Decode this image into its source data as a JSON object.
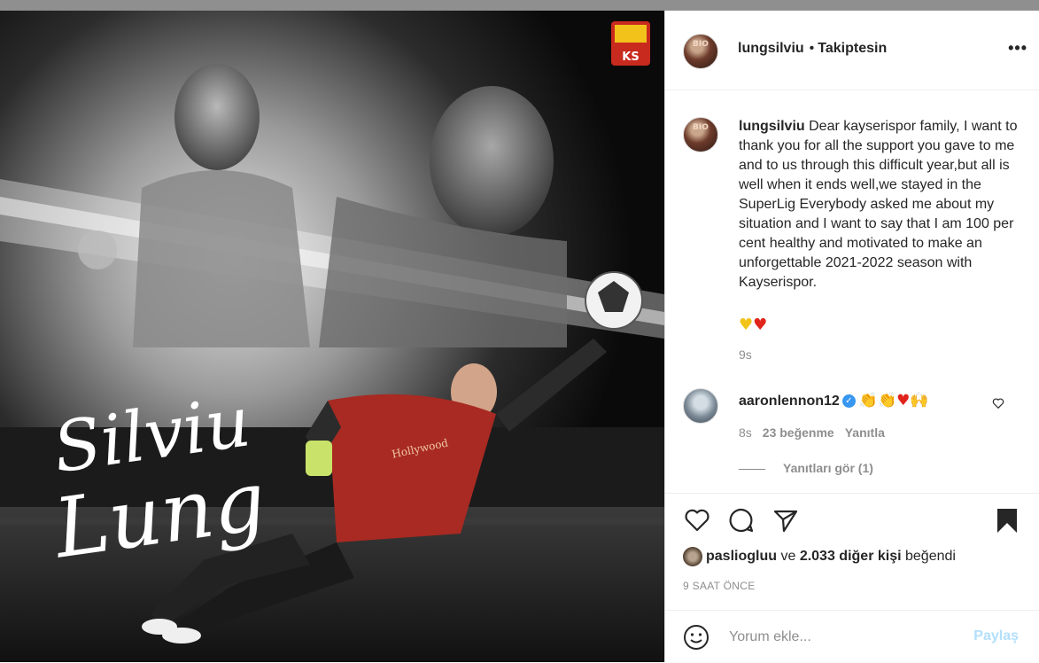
{
  "post": {
    "username": "lungsilviu",
    "dot": "•",
    "follow_status": "Takiptesin",
    "more_label": "•••",
    "avatar_text": "BIO",
    "image": {
      "script_name_1": "Silviu",
      "script_name_2": "Lung",
      "club_badge_text": "KS",
      "sponsor_text": "Hollywood"
    }
  },
  "caption": {
    "username": "lungsilviu",
    "text": "Dear kayserispor family, I want to thank you for all the support you gave to me and to us through this difficult year,but all is well when it ends well,we stayed in the SuperLig Everybody asked me about my situation and I want to say that I am 100 per cent healthy and motivated to make an unforgettable 2021-2022 season with Kayserispor.",
    "heart_yellow": "♥",
    "heart_red": "♥",
    "time": "9s"
  },
  "comment": {
    "username": "aaronlennon12",
    "verified": "✓",
    "emojis_clap": "👏👏",
    "emoji_heart": "♥",
    "emoji_hands": "🙌",
    "time": "8s",
    "likes": "23 beğenme",
    "reply": "Yanıtla",
    "view_replies": "Yanıtları gör (1)"
  },
  "likes": {
    "user": "pasliogluu",
    "connector": "ve",
    "others": "2.033 diğer kişi",
    "suffix": "beğendi"
  },
  "timestamp": "9 SAAT ÖNCE",
  "add_comment": {
    "placeholder": "Yorum ekle...",
    "post_label": "Paylaş"
  },
  "colors": {
    "accent_blue": "#0095f6",
    "disabled_blue": "#b2dffc",
    "verified": "#3897f0"
  }
}
